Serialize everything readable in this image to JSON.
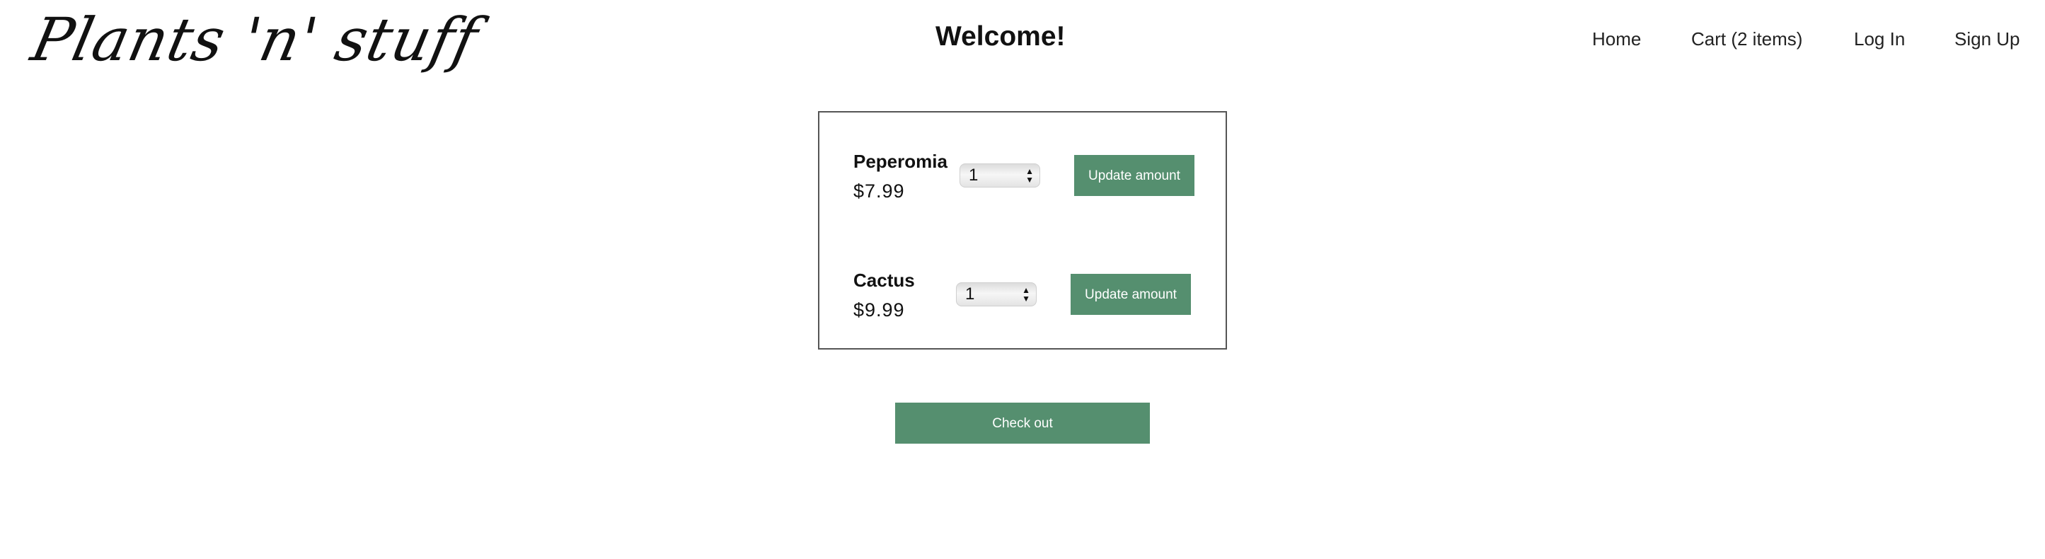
{
  "header": {
    "logo_text": "Plants 'n' stuff",
    "welcome": "Welcome!"
  },
  "nav": {
    "home": "Home",
    "cart": "Cart (2 items)",
    "login": "Log In",
    "signup": "Sign Up"
  },
  "cart": {
    "items": [
      {
        "name": "Peperomia",
        "price": "$7.99",
        "quantity": "1",
        "update_label": "Update amount"
      },
      {
        "name": "Cactus",
        "price": "$9.99",
        "quantity": "1",
        "update_label": "Update amount"
      }
    ],
    "checkout_label": "Check out"
  },
  "colors": {
    "button": "#558f6f",
    "button_text": "#ffffff",
    "border": "#555555"
  },
  "icons": {
    "quantity_arrows": "up-down-arrows-icon"
  }
}
